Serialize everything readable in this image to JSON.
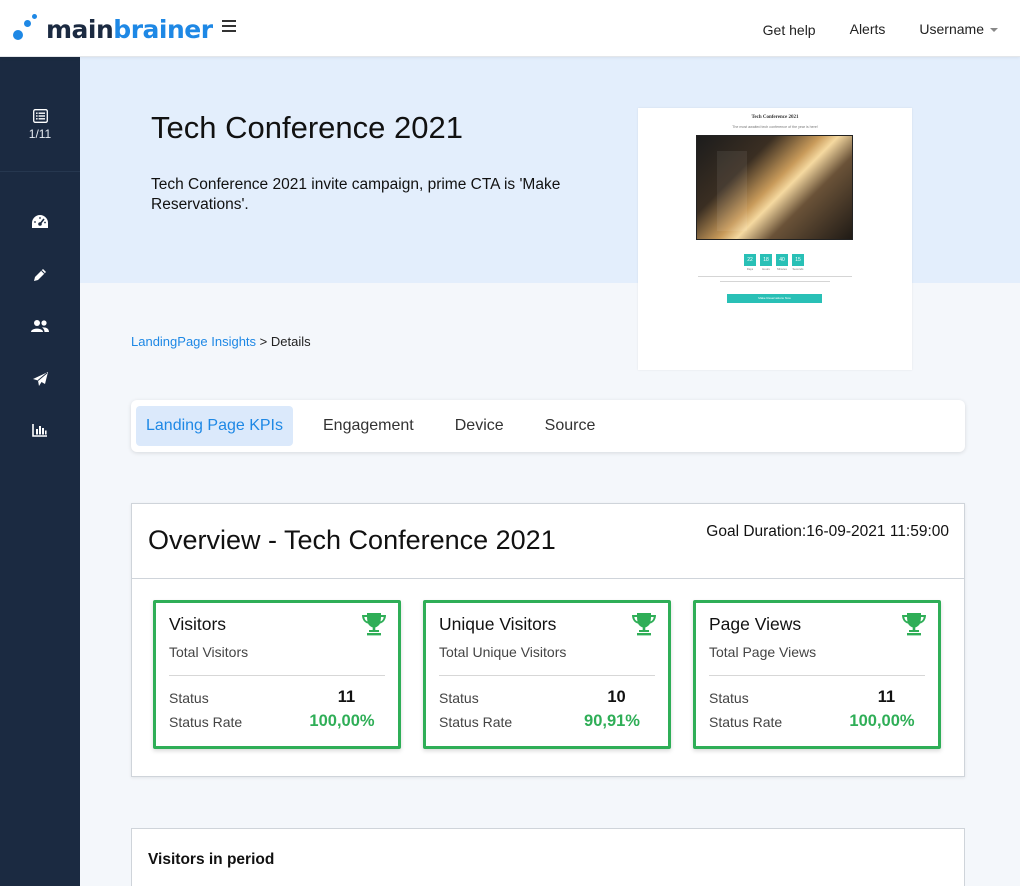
{
  "header": {
    "logo_part1": "main",
    "logo_part2": "brainer",
    "nav": {
      "help": "Get help",
      "alerts": "Alerts",
      "username": "Username"
    }
  },
  "sidebar": {
    "counter": "1/11",
    "icons": [
      "list-icon",
      "dashboard-gauge-icon",
      "pencil-icon",
      "users-icon",
      "paper-plane-icon",
      "bar-chart-icon"
    ]
  },
  "hero": {
    "title": "Tech Conference 2021",
    "description": "Tech Conference 2021 invite campaign, prime CTA is 'Make Reservations'."
  },
  "preview": {
    "title": "Tech Conference 2021",
    "subtitle": "The most awaited tech conference of the year is here!",
    "countdown": [
      "22",
      "18",
      "40",
      "15"
    ],
    "countdown_labels": [
      "Days",
      "Hours",
      "Minutes",
      "Seconds"
    ],
    "button": "Make Reservations Now"
  },
  "breadcrumb": {
    "link": "LandingPage Insights",
    "separator": ">",
    "current": "Details"
  },
  "tabs": [
    {
      "label": "Landing Page KPIs",
      "active": true
    },
    {
      "label": "Engagement",
      "active": false
    },
    {
      "label": "Device",
      "active": false
    },
    {
      "label": "Source",
      "active": false
    }
  ],
  "overview": {
    "title": "Overview - Tech Conference 2021",
    "goal": "Goal Duration:16-09-2021 11:59:00",
    "kpis": [
      {
        "title": "Visitors",
        "subtitle": "Total Visitors",
        "status_label": "Status",
        "status": "11",
        "rate_label": "Status Rate",
        "rate": "100,00%"
      },
      {
        "title": "Unique Visitors",
        "subtitle": "Total Unique Visitors",
        "status_label": "Status",
        "status": "10",
        "rate_label": "Status Rate",
        "rate": "90,91%"
      },
      {
        "title": "Page Views",
        "subtitle": "Total Page Views",
        "status_label": "Status",
        "status": "11",
        "rate_label": "Status Rate",
        "rate": "100,00%"
      }
    ]
  },
  "period": {
    "title": "Visitors in period"
  },
  "colors": {
    "brand_blue": "#1e88e5",
    "sidebar_bg": "#1b2a41",
    "success_green": "#2fae57",
    "hero_bg": "#e3eefc"
  }
}
